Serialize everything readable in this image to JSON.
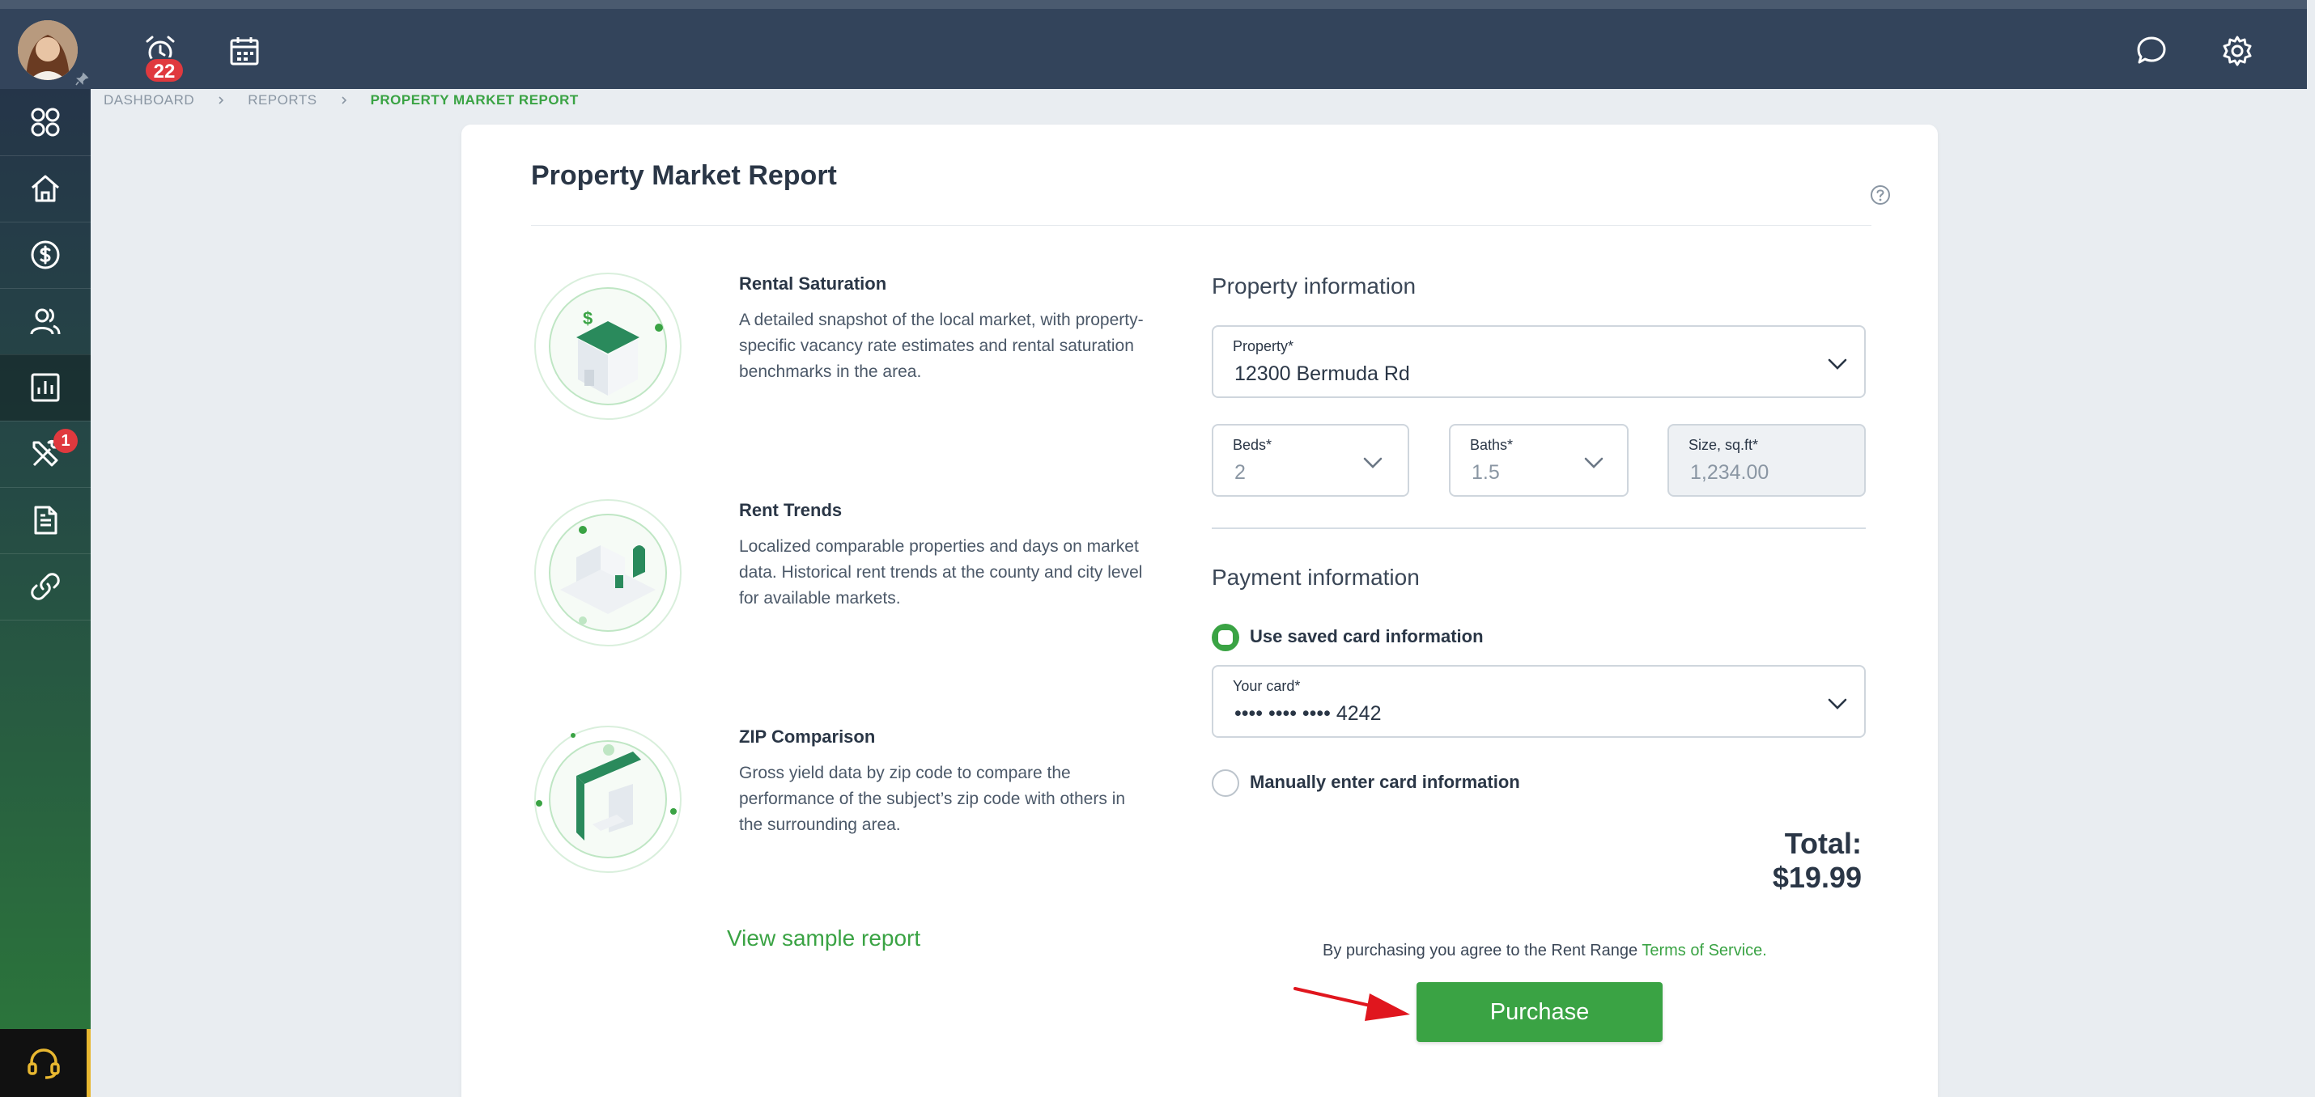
{
  "topbar": {
    "alarm_badge": "22",
    "icons": [
      "avatar",
      "pin-icon",
      "alarm-clock-icon",
      "calendar-icon",
      "chat-icon",
      "gear-icon"
    ]
  },
  "sidebar": {
    "items": [
      {
        "name": "apps-icon"
      },
      {
        "name": "home-icon"
      },
      {
        "name": "dollar-icon"
      },
      {
        "name": "users-icon"
      },
      {
        "name": "reports-icon",
        "active": true
      },
      {
        "name": "tools-icon",
        "badge": "1"
      },
      {
        "name": "document-icon"
      },
      {
        "name": "link-icon"
      }
    ],
    "support_icon": "headset-icon"
  },
  "breadcrumb": [
    "DASHBOARD",
    "REPORTS",
    "PROPERTY MARKET REPORT"
  ],
  "page": {
    "title": "Property Market Report",
    "features": [
      {
        "title": "Rental Saturation",
        "description": "A detailed snapshot of the local market, with property-specific vacancy rate estimates and rental saturation benchmarks in the area."
      },
      {
        "title": "Rent Trends",
        "description": "Localized comparable properties and days on market data. Historical rent trends at the county and city level for available markets."
      },
      {
        "title": "ZIP Comparison",
        "description": "Gross yield data by zip code to compare the performance of the subject’s zip code with others in the surrounding area."
      }
    ],
    "sample_link": "View sample report"
  },
  "property_info": {
    "title": "Property information",
    "property_label": "Property*",
    "property_value": "12300 Bermuda Rd",
    "beds_label": "Beds*",
    "beds_value": "2",
    "baths_label": "Baths*",
    "baths_value": "1.5",
    "size_label": "Size, sq.ft*",
    "size_value": "1,234.00"
  },
  "payment_info": {
    "title": "Payment information",
    "saved_option": "Use saved card information",
    "card_label": "Your card*",
    "card_value": "•••• •••• •••• 4242",
    "manual_option": "Manually enter card information",
    "total": "Total: $19.99",
    "terms_prefix": "By purchasing you agree to the Rent Range",
    "terms_link": "Terms of Service.",
    "purchase_label": "Purchase"
  },
  "colors": {
    "accent": "#3aa344",
    "topbar": "#33445b",
    "badge": "#e0393e",
    "annotation_arrow": "#e0161e"
  }
}
